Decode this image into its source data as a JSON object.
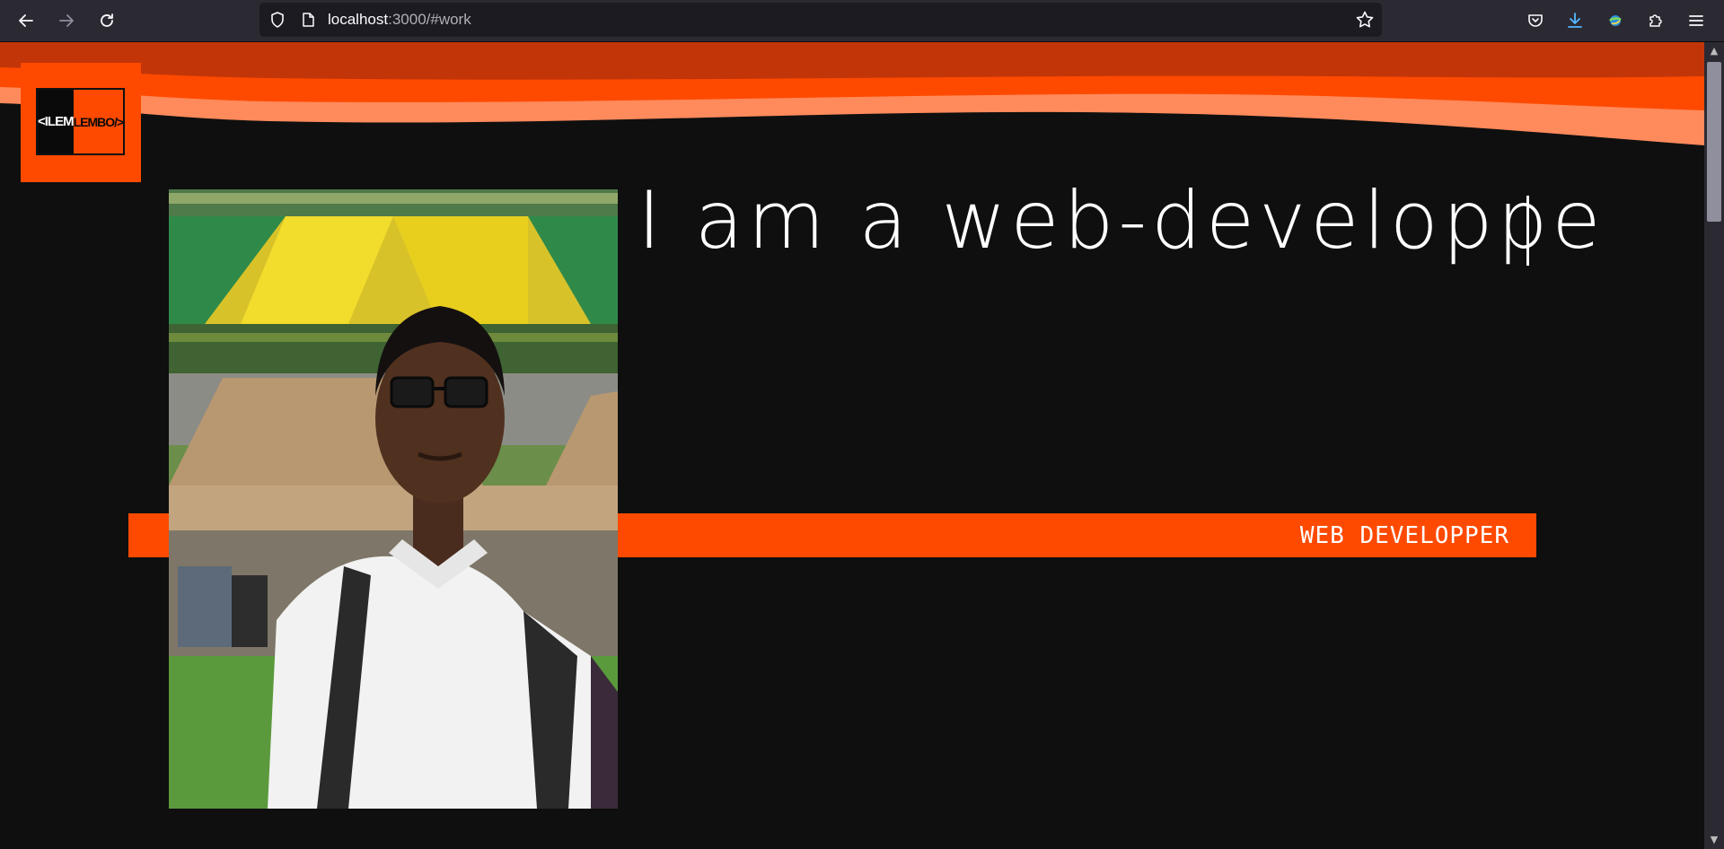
{
  "browser": {
    "url_host": "localhost",
    "url_rest": ":3000/#work"
  },
  "logo": {
    "left_text": "<ILEM",
    "right_text": "LEMBO/>"
  },
  "hero": {
    "headline": "I am a web-developpe",
    "banner_label": "WEB DEVELOPPER"
  },
  "colors": {
    "accent": "#fe4a00",
    "wave_dark": "#c23508",
    "wave_light": "#ff8a5c",
    "background": "#0f0f0f"
  },
  "icons": {
    "back": "arrow-left-icon",
    "forward": "arrow-right-icon",
    "reload": "reload-icon",
    "shield": "shield-icon",
    "page": "page-icon",
    "bookmark": "star-icon",
    "pocket": "pocket-icon",
    "downloads": "download-icon",
    "vpn": "globe-icon",
    "extensions": "puzzle-icon",
    "menu": "hamburger-icon"
  }
}
